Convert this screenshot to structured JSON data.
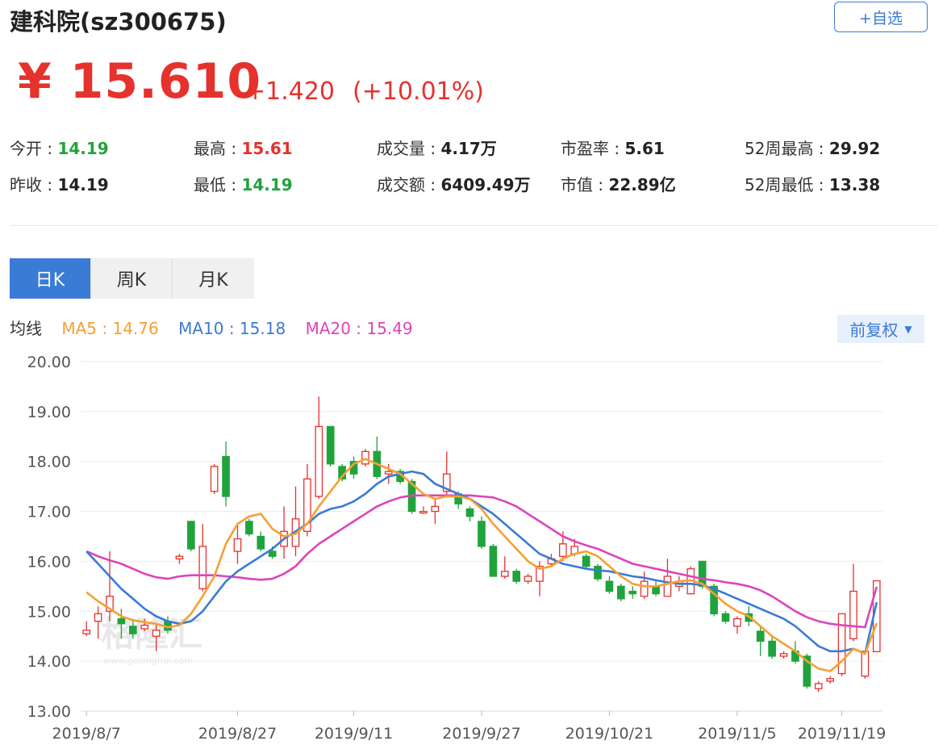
{
  "header": {
    "title": "建科院(sz300675)",
    "fav_label": "+自选"
  },
  "quote": {
    "price": "¥ 15.610",
    "change": "+1.420",
    "change_pct": "(+10.01%)"
  },
  "stats": [
    {
      "label": "今开 : ",
      "value": "14.19",
      "tone": "green"
    },
    {
      "label": "最高 : ",
      "value": "15.61",
      "tone": "red"
    },
    {
      "label": "成交量 : ",
      "value": "4.17万",
      "tone": ""
    },
    {
      "label": "市盈率 : ",
      "value": "5.61",
      "tone": ""
    },
    {
      "label": "52周最高 : ",
      "value": "29.92",
      "tone": ""
    },
    {
      "label": "昨收 : ",
      "value": "14.19",
      "tone": ""
    },
    {
      "label": "最低 : ",
      "value": "14.19",
      "tone": "green"
    },
    {
      "label": "成交额 : ",
      "value": "6409.49万",
      "tone": ""
    },
    {
      "label": "市值 : ",
      "value": "22.89亿",
      "tone": ""
    },
    {
      "label": "52周最低 : ",
      "value": "13.38",
      "tone": ""
    }
  ],
  "tabs": [
    {
      "label": "日K",
      "active": true
    },
    {
      "label": "周K",
      "active": false
    },
    {
      "label": "月K",
      "active": false
    }
  ],
  "ma_legend": {
    "title": "均线",
    "ma5": "MA5 : 14.76",
    "ma10": "MA10 : 15.18",
    "ma20": "MA20 : 15.49"
  },
  "adjust_label": "前复权",
  "watermark": {
    "main": "格隆汇",
    "sub": "www.gelonghui.com"
  },
  "colors": {
    "up": "#e5322d",
    "down": "#21a33c",
    "ma5": "#f5a033",
    "ma10": "#3a7bd5",
    "ma20": "#dd44bb",
    "accent": "#3a7bd5"
  },
  "chart_data": {
    "type": "candlestick",
    "ylim": [
      13.0,
      20.0
    ],
    "yticks": [
      "20.00",
      "19.00",
      "18.00",
      "17.00",
      "16.00",
      "15.00",
      "14.00",
      "13.00"
    ],
    "xtick_labels": [
      "2019/8/7",
      "2019/8/27",
      "2019/9/11",
      "2019/9/27",
      "2019/10/21",
      "2019/11/5",
      "2019/11/19"
    ],
    "xtick_index": [
      0,
      13,
      23,
      34,
      45,
      56,
      65
    ],
    "grid": true,
    "candles": [
      [
        14.55,
        14.62,
        14.8,
        14.5
      ],
      [
        14.8,
        14.95,
        15.1,
        14.45
      ],
      [
        15.0,
        15.3,
        16.2,
        14.8
      ],
      [
        14.85,
        14.75,
        15.05,
        14.45
      ],
      [
        14.7,
        14.55,
        14.85,
        14.45
      ],
      [
        14.65,
        14.72,
        14.85,
        14.6
      ],
      [
        14.5,
        14.62,
        14.75,
        14.2
      ],
      [
        14.8,
        14.62,
        14.9,
        14.55
      ],
      [
        16.05,
        16.1,
        16.15,
        15.95
      ],
      [
        16.8,
        16.25,
        16.8,
        16.2
      ],
      [
        15.45,
        16.3,
        16.75,
        15.4
      ],
      [
        17.4,
        17.9,
        17.95,
        17.35
      ],
      [
        18.1,
        17.3,
        18.4,
        17.1
      ],
      [
        16.2,
        16.45,
        16.75,
        15.95
      ],
      [
        16.8,
        16.55,
        16.85,
        16.5
      ],
      [
        16.5,
        16.25,
        16.6,
        16.2
      ],
      [
        16.2,
        16.1,
        16.3,
        16.05
      ],
      [
        16.3,
        16.6,
        17.1,
        16.05
      ],
      [
        16.3,
        16.85,
        17.5,
        16.1
      ],
      [
        16.6,
        17.65,
        17.95,
        16.5
      ],
      [
        17.3,
        18.7,
        19.3,
        17.25
      ],
      [
        18.7,
        17.95,
        18.7,
        17.9
      ],
      [
        17.9,
        17.65,
        17.95,
        17.6
      ],
      [
        18.0,
        17.75,
        18.1,
        17.65
      ],
      [
        17.95,
        18.2,
        18.25,
        17.9
      ],
      [
        18.2,
        17.7,
        18.5,
        17.65
      ],
      [
        17.75,
        17.8,
        17.95,
        17.55
      ],
      [
        17.8,
        17.6,
        17.85,
        17.55
      ],
      [
        17.6,
        17.0,
        17.65,
        16.95
      ],
      [
        17.0,
        17.0,
        17.1,
        16.95
      ],
      [
        17.0,
        17.1,
        17.25,
        16.75
      ],
      [
        17.4,
        17.75,
        18.2,
        17.3
      ],
      [
        17.35,
        17.15,
        17.4,
        17.05
      ],
      [
        17.05,
        16.9,
        17.1,
        16.8
      ],
      [
        16.8,
        16.3,
        16.9,
        16.25
      ],
      [
        16.3,
        15.7,
        16.35,
        15.7
      ],
      [
        15.7,
        15.8,
        16.1,
        15.65
      ],
      [
        15.8,
        15.6,
        15.85,
        15.55
      ],
      [
        15.6,
        15.7,
        15.75,
        15.55
      ],
      [
        15.6,
        15.9,
        16.0,
        15.3
      ],
      [
        15.95,
        16.05,
        16.15,
        15.9
      ],
      [
        16.1,
        16.35,
        16.6,
        16.0
      ],
      [
        16.15,
        16.3,
        16.45,
        16.1
      ],
      [
        16.1,
        15.9,
        16.15,
        15.85
      ],
      [
        15.9,
        15.65,
        15.95,
        15.6
      ],
      [
        15.6,
        15.4,
        15.7,
        15.35
      ],
      [
        15.5,
        15.25,
        15.55,
        15.2
      ],
      [
        15.4,
        15.35,
        15.5,
        15.25
      ],
      [
        15.3,
        15.6,
        15.8,
        15.25
      ],
      [
        15.5,
        15.35,
        15.6,
        15.3
      ],
      [
        15.3,
        15.7,
        16.05,
        15.3
      ],
      [
        15.5,
        15.6,
        15.7,
        15.4
      ],
      [
        15.35,
        15.85,
        15.9,
        15.35
      ],
      [
        16.0,
        15.5,
        16.0,
        15.45
      ],
      [
        15.5,
        14.95,
        15.55,
        14.9
      ],
      [
        14.95,
        14.8,
        15.0,
        14.75
      ],
      [
        14.7,
        14.85,
        14.9,
        14.55
      ],
      [
        14.95,
        14.8,
        15.1,
        14.7
      ],
      [
        14.6,
        14.4,
        14.7,
        14.1
      ],
      [
        14.4,
        14.1,
        14.5,
        14.05
      ],
      [
        14.1,
        14.15,
        14.2,
        14.05
      ],
      [
        14.2,
        14.0,
        14.4,
        13.95
      ],
      [
        14.1,
        13.5,
        14.15,
        13.45
      ],
      [
        13.45,
        13.55,
        13.6,
        13.38
      ],
      [
        13.6,
        13.65,
        13.7,
        13.55
      ],
      [
        13.75,
        14.95,
        14.95,
        13.7
      ],
      [
        14.45,
        15.4,
        15.95,
        14.4
      ],
      [
        13.7,
        14.2,
        14.2,
        13.65
      ],
      [
        14.19,
        15.61,
        15.61,
        14.19
      ]
    ],
    "ma5": [
      15.38,
      15.2,
      15.05,
      14.9,
      14.82,
      14.78,
      14.75,
      14.68,
      14.72,
      14.95,
      15.3,
      15.7,
      16.35,
      16.75,
      16.9,
      16.95,
      16.65,
      16.5,
      16.55,
      16.75,
      17.1,
      17.4,
      17.7,
      17.95,
      18.05,
      17.95,
      17.85,
      17.75,
      17.55,
      17.35,
      17.25,
      17.3,
      17.3,
      17.25,
      17.05,
      16.75,
      16.5,
      16.25,
      16.0,
      15.85,
      15.9,
      16.05,
      16.15,
      16.2,
      16.1,
      15.9,
      15.7,
      15.55,
      15.5,
      15.5,
      15.55,
      15.6,
      15.62,
      15.55,
      15.35,
      15.15,
      15.0,
      14.9,
      14.7,
      14.5,
      14.35,
      14.2,
      14.0,
      13.85,
      13.8,
      14.0,
      14.25,
      14.15,
      14.76
    ],
    "ma10": [
      16.2,
      15.95,
      15.7,
      15.45,
      15.25,
      15.05,
      14.9,
      14.8,
      14.75,
      14.8,
      15.0,
      15.3,
      15.6,
      15.8,
      15.95,
      16.1,
      16.25,
      16.45,
      16.6,
      16.75,
      16.95,
      17.05,
      17.1,
      17.2,
      17.35,
      17.55,
      17.7,
      17.75,
      17.8,
      17.75,
      17.55,
      17.45,
      17.35,
      17.25,
      17.1,
      16.95,
      16.75,
      16.55,
      16.35,
      16.15,
      16.05,
      15.95,
      15.9,
      15.85,
      15.82,
      15.8,
      15.75,
      15.7,
      15.67,
      15.62,
      15.58,
      15.55,
      15.55,
      15.52,
      15.45,
      15.35,
      15.25,
      15.15,
      15.05,
      14.95,
      14.85,
      14.7,
      14.5,
      14.3,
      14.2,
      14.2,
      14.25,
      14.15,
      15.18
    ],
    "ma20": [
      16.2,
      16.1,
      16.02,
      15.95,
      15.85,
      15.75,
      15.68,
      15.65,
      15.7,
      15.72,
      15.72,
      15.72,
      15.7,
      15.68,
      15.65,
      15.63,
      15.65,
      15.75,
      15.9,
      16.15,
      16.35,
      16.5,
      16.65,
      16.8,
      16.95,
      17.1,
      17.2,
      17.28,
      17.32,
      17.32,
      17.32,
      17.32,
      17.32,
      17.32,
      17.3,
      17.28,
      17.2,
      17.1,
      16.95,
      16.8,
      16.65,
      16.5,
      16.4,
      16.32,
      16.25,
      16.15,
      16.05,
      15.95,
      15.9,
      15.85,
      15.8,
      15.75,
      15.7,
      15.65,
      15.62,
      15.58,
      15.55,
      15.5,
      15.42,
      15.3,
      15.15,
      15.0,
      14.88,
      14.8,
      14.75,
      14.72,
      14.7,
      14.68,
      15.49
    ]
  }
}
